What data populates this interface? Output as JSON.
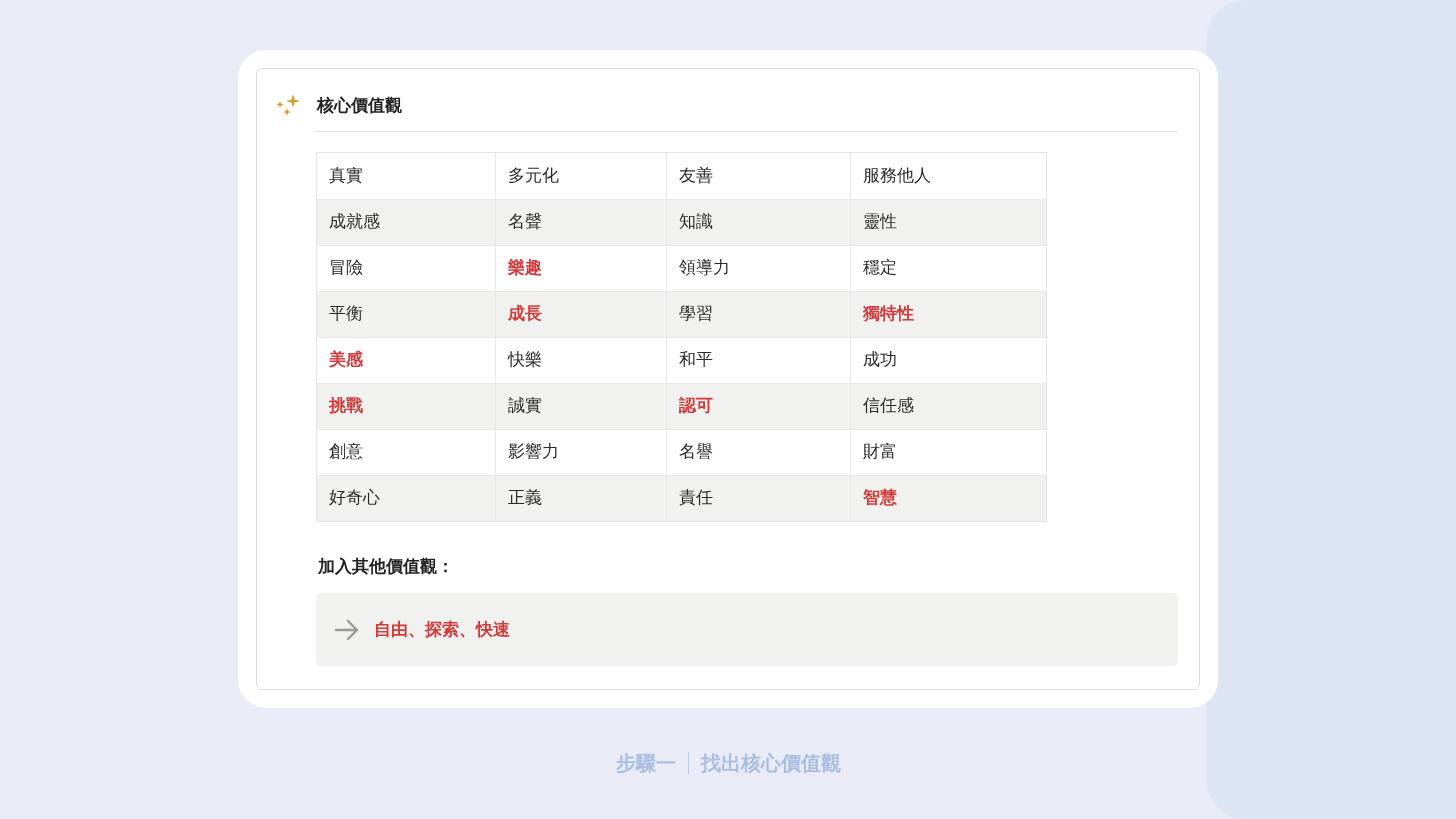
{
  "card": {
    "title": "核心價值觀"
  },
  "table": {
    "rows": [
      [
        {
          "text": "真實",
          "highlighted": false
        },
        {
          "text": "多元化",
          "highlighted": false
        },
        {
          "text": "友善",
          "highlighted": false
        },
        {
          "text": "服務他人",
          "highlighted": false
        }
      ],
      [
        {
          "text": "成就感",
          "highlighted": false
        },
        {
          "text": "名聲",
          "highlighted": false
        },
        {
          "text": "知識",
          "highlighted": false
        },
        {
          "text": "靈性",
          "highlighted": false
        }
      ],
      [
        {
          "text": "冒險",
          "highlighted": false
        },
        {
          "text": "樂趣",
          "highlighted": true
        },
        {
          "text": "領導力",
          "highlighted": false
        },
        {
          "text": "穩定",
          "highlighted": false
        }
      ],
      [
        {
          "text": "平衡",
          "highlighted": false
        },
        {
          "text": "成長",
          "highlighted": true
        },
        {
          "text": "學習",
          "highlighted": false
        },
        {
          "text": "獨特性",
          "highlighted": true
        }
      ],
      [
        {
          "text": "美感",
          "highlighted": true
        },
        {
          "text": "快樂",
          "highlighted": false
        },
        {
          "text": "和平",
          "highlighted": false
        },
        {
          "text": "成功",
          "highlighted": false
        }
      ],
      [
        {
          "text": "挑戰",
          "highlighted": true
        },
        {
          "text": "誠實",
          "highlighted": false
        },
        {
          "text": "認可",
          "highlighted": true
        },
        {
          "text": "信任感",
          "highlighted": false
        }
      ],
      [
        {
          "text": "創意",
          "highlighted": false
        },
        {
          "text": "影響力",
          "highlighted": false
        },
        {
          "text": "名譽",
          "highlighted": false
        },
        {
          "text": "財富",
          "highlighted": false
        }
      ],
      [
        {
          "text": "好奇心",
          "highlighted": false
        },
        {
          "text": "正義",
          "highlighted": false
        },
        {
          "text": "責任",
          "highlighted": false
        },
        {
          "text": "智慧",
          "highlighted": true
        }
      ]
    ]
  },
  "other": {
    "label": "加入其他價值觀：",
    "value": "自由、探索、快速"
  },
  "caption": {
    "step": "步驟一",
    "title": "找出核心價值觀"
  }
}
